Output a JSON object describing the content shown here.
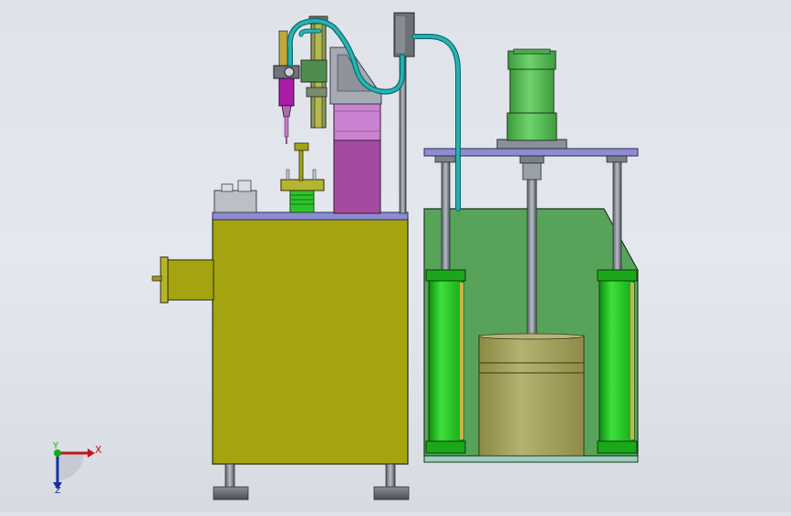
{
  "viewport": {
    "background": "#e1e5eb",
    "view": "front elevation",
    "colors": {
      "olive_cabinet": "#a3a40f",
      "green_tank": "#57a35a",
      "green_cylinder": "#22c21b",
      "drum": "#a9a565",
      "magenta_block": "#a64aa0",
      "pink_block": "#c982d1",
      "teal_hose": "#1ea3a3",
      "motor_green": "#5ec45d",
      "plate_lavender": "#8e8cd3",
      "syringe_magenta": "#a81ca8"
    }
  },
  "triad": {
    "x_label": "X",
    "y_label": "Y",
    "z_label": "Z",
    "x_color": "#c01818",
    "y_color": "#1aa81a",
    "z_color": "#1a2aa8"
  }
}
